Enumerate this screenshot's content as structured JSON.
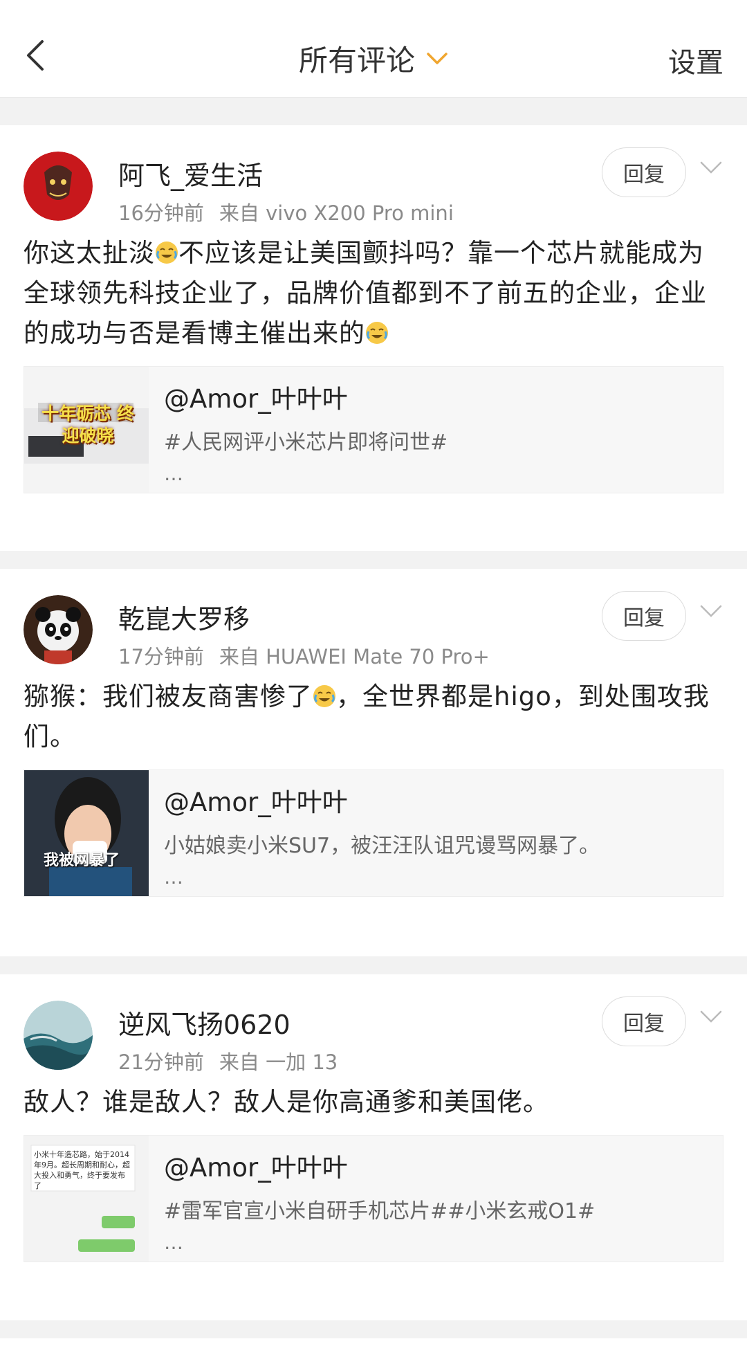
{
  "header": {
    "title": "所有评论",
    "settings_label": "设置"
  },
  "comments": [
    {
      "username": "阿飞_爱生活",
      "time": "16分钟前",
      "source": "来自 vivo X200 Pro mini",
      "reply_label": "回复",
      "text_parts": [
        "你这太扯淡",
        "不应该是让美国颤抖吗？靠一个芯片就能成为全球领先科技企业了，品牌价值都到不了前五的企业，企业的成功与否是看博主催出来的",
        ""
      ],
      "quote": {
        "name": "@Amor_叶叶叶",
        "topic": "#人民网评小米芯片即将问世#",
        "dots": "…",
        "thumb_text": "十年砺芯 终迎破晓"
      }
    },
    {
      "username": "乾崑大罗移",
      "time": "17分钟前",
      "source": "来自 HUAWEI Mate 70 Pro+",
      "reply_label": "回复",
      "text_parts": [
        "猕猴：我们被友商害惨了",
        "，全世界都是higo，到处围攻我们。"
      ],
      "quote": {
        "name": "@Amor_叶叶叶",
        "topic": "小姑娘卖小米SU7，被汪汪队诅咒谩骂网暴了。",
        "dots": "…",
        "thumb_text": "我被网暴了"
      }
    },
    {
      "username": "逆风飞扬0620",
      "time": "21分钟前",
      "source": "来自 一加 13",
      "reply_label": "回复",
      "text_parts": [
        "敌人？谁是敌人？敌人是你高通爹和美国佬。"
      ],
      "quote": {
        "name": "@Amor_叶叶叶",
        "topic": "#雷军官宣小米自研手机芯片##小米玄戒O1#",
        "dots": "…",
        "thumb_text": "小米十年造芯路，始于2014年9月。超长周期和耐心，超大投入和勇气，终于要发布了"
      }
    }
  ],
  "icons": {
    "back": "chevron-left-icon",
    "dropdown": "chevron-down-icon",
    "more": "chevron-down-icon",
    "emoji_laugh_cry": "laughing-crying-emoji"
  },
  "colors": {
    "accent": "#f0a630",
    "page_bg": "#f2f2f2",
    "quote_bg": "#f7f7f7"
  }
}
